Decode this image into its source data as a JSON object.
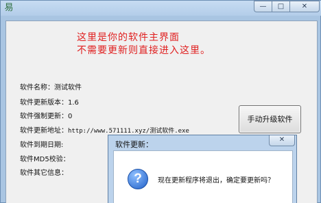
{
  "window": {
    "app_icon_glyph": "易",
    "minimize_glyph": "—",
    "maximize_glyph": "□",
    "close_glyph": "✕"
  },
  "notice": {
    "line1": "这里是你的软件主界面",
    "line2": "不需要更新则直接进入这里。"
  },
  "info": {
    "name": "软件名称：测试软件",
    "version": "软件更新版本：1.6",
    "force": "软件强制更新：0",
    "url_label": "软件更新地址：",
    "url_value": "http://www.571111.xyz/测试软件.exe",
    "expiry": "软件到期日期:",
    "md5": "软件MD5校验：",
    "other": "软件其它信息："
  },
  "upgrade_button": "手动升级软件",
  "dialog": {
    "title": "软件更新：",
    "close_glyph": "✕",
    "icon_glyph": "?",
    "message": "现在更新程序将退出，确定要更新吗？"
  }
}
